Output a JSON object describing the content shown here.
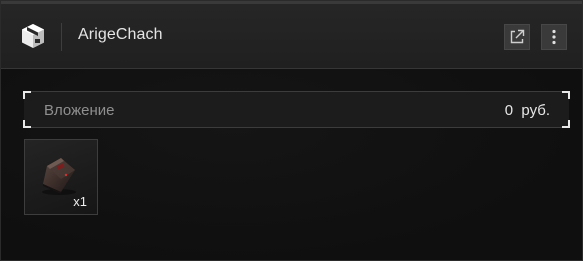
{
  "header": {
    "title": "ArigeChach",
    "app_icon": "cube-box-icon",
    "buttons": [
      {
        "name": "open-external-icon"
      },
      {
        "name": "more-vertical-icon"
      }
    ]
  },
  "value_field": {
    "label": "Вложение",
    "value": "0  руб."
  },
  "items": [
    {
      "icon": "item-case-icon",
      "count": "x1"
    }
  ],
  "colors": {
    "background": "#141414",
    "header": "#232323",
    "text": "#e4e4e4",
    "muted_text": "#8f8f8f",
    "bracket": "#e9e9e9"
  }
}
